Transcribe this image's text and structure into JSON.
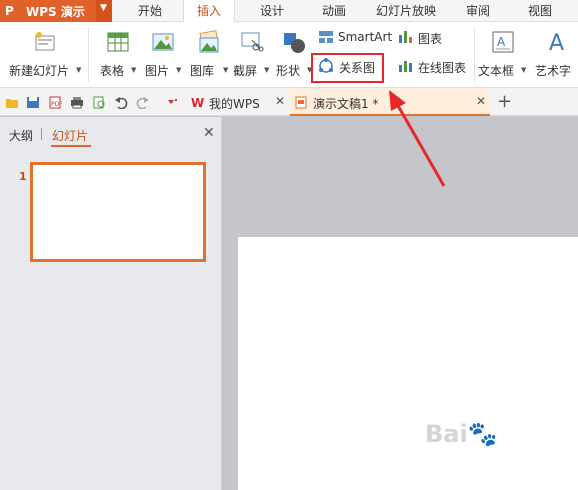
{
  "app": {
    "name": "WPS 演示"
  },
  "menu": {
    "tabs": [
      "开始",
      "插入",
      "设计",
      "动画",
      "幻灯片放映",
      "审阅",
      "视图"
    ],
    "active_tab": "插入"
  },
  "ribbon": {
    "new_slide": "新建幻灯片",
    "table": "表格",
    "picture": "图片",
    "gallery": "图库",
    "screenshot": "截屏",
    "shape": "形状",
    "smartart": "SmartArt",
    "relation_chart": "关系图",
    "chart": "图表",
    "online_chart": "在线图表",
    "textbox": "文本框",
    "wordart": "艺术字"
  },
  "doc_tabs": [
    {
      "label": "我的WPS"
    },
    {
      "label": "演示文稿1 *"
    }
  ],
  "panel": {
    "outline": "大纲",
    "slides": "幻灯片",
    "slide_number": "1"
  },
  "colors": {
    "accent": "#e0622a",
    "highlight": "#e8262b"
  }
}
